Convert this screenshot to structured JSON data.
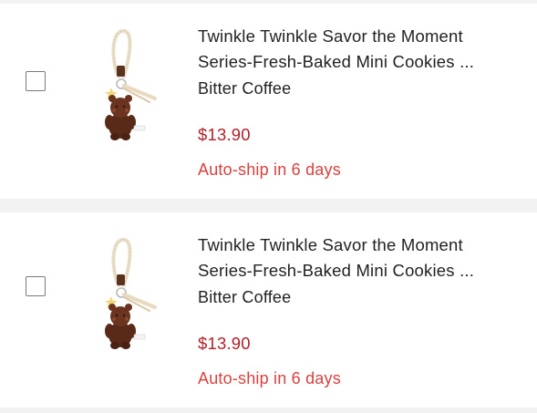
{
  "cart": {
    "items": [
      {
        "title_line1": "Twinkle Twinkle Savor the Moment",
        "title_line2": "Series-Fresh-Baked Mini Cookies ...",
        "variant": "Bitter Coffee",
        "price": "$13.90",
        "autoship": "Auto-ship in 6 days",
        "image_icon": "cookie-keychain-icon",
        "checked": false
      },
      {
        "title_line1": "Twinkle Twinkle Savor the Moment",
        "title_line2": "Series-Fresh-Baked Mini Cookies ...",
        "variant": "Bitter Coffee",
        "price": "$13.90",
        "autoship": "Auto-ship in 6 days",
        "image_icon": "cookie-keychain-icon",
        "checked": false
      }
    ]
  },
  "colors": {
    "price": "#b2202a",
    "autoship": "#d9413f",
    "text": "#222222",
    "separator": "#f2f2f2"
  }
}
